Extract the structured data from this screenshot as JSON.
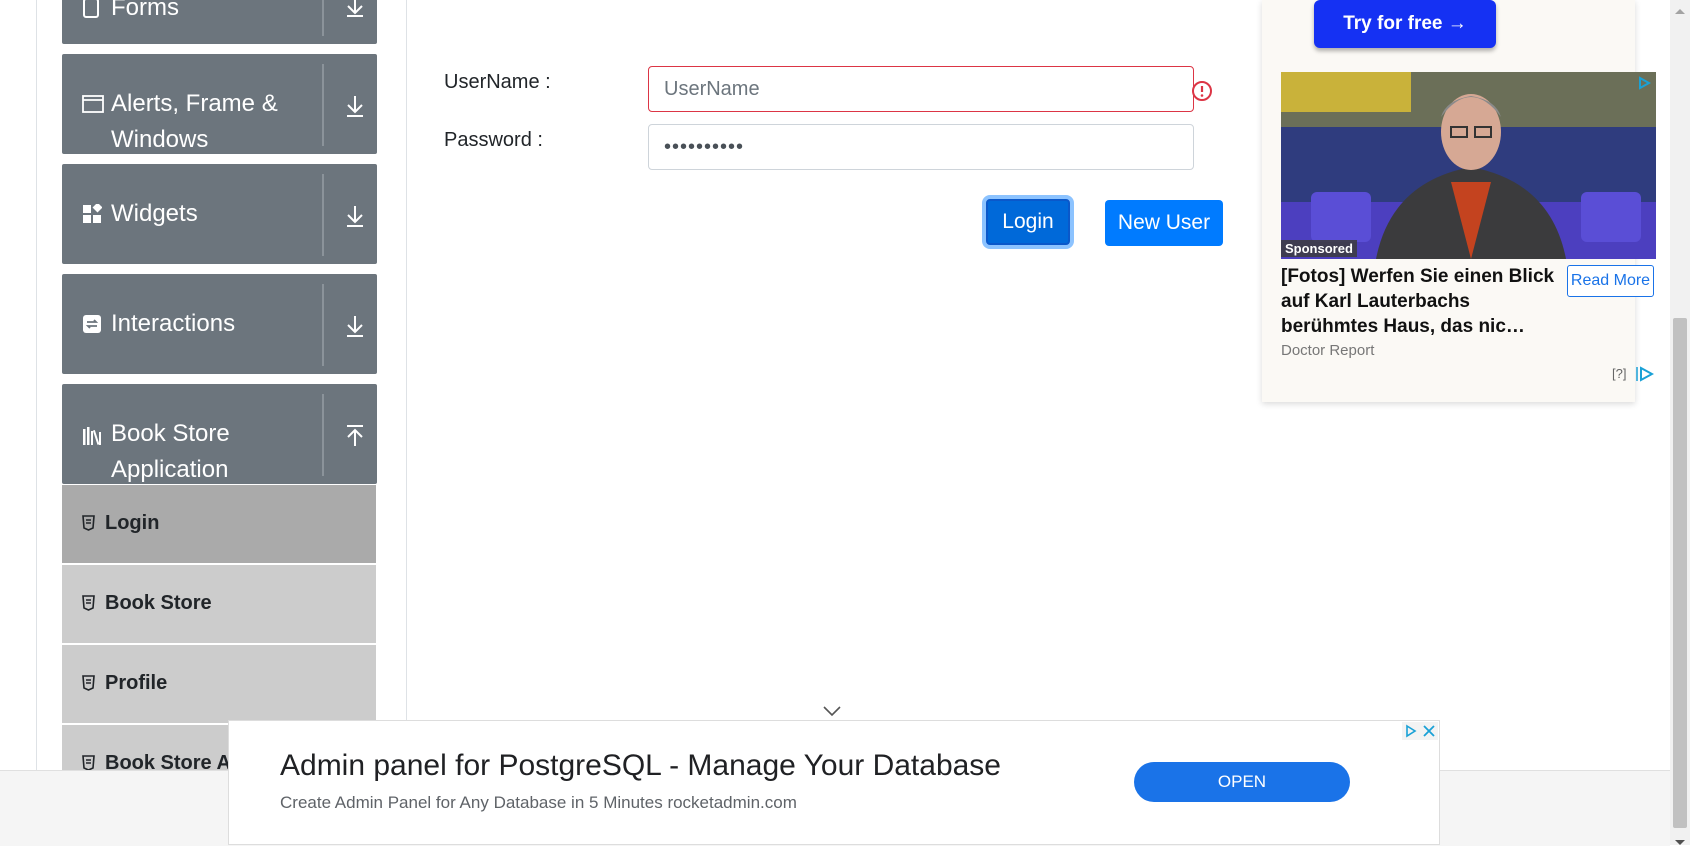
{
  "sidebar": {
    "groups": [
      {
        "title": "Forms",
        "icon": "form-icon",
        "expanded": false
      },
      {
        "title": "Alerts, Frame & Windows",
        "icon": "window-icon",
        "expanded": false
      },
      {
        "title": "Widgets",
        "icon": "widgets-icon",
        "expanded": false
      },
      {
        "title": "Interactions",
        "icon": "interactions-icon",
        "expanded": false
      },
      {
        "title": "Book Store Application",
        "icon": "books-icon",
        "expanded": true
      }
    ],
    "book_store_items": [
      {
        "label": "Login",
        "active": true
      },
      {
        "label": "Book Store",
        "active": false
      },
      {
        "label": "Profile",
        "active": false
      },
      {
        "label": "Book Store API",
        "active": false
      }
    ]
  },
  "form": {
    "username_label": "UserName :",
    "username_placeholder": "UserName",
    "username_value": "",
    "password_label": "Password :",
    "password_value": "••••••••••",
    "login_button": "Login",
    "new_user_button": "New User"
  },
  "side_ad": {
    "try_button": "Try for free →",
    "sponsored": "Sponsored",
    "headline": "[Fotos] Werfen Sie einen Blick auf Karl Lauterbachs berühmtes Haus, das nic…",
    "source": "Doctor Report",
    "read_more": "Read More",
    "help": "[?]"
  },
  "bottom_ad": {
    "title": "Admin panel for PostgreSQL - Manage Your Database",
    "subtitle": "Create Admin Panel for Any Database in 5 Minutes rocketadmin.com",
    "open_button": "OPEN"
  },
  "colors": {
    "sidebar_group": "#6c757d",
    "menu_item": "#cccccc",
    "menu_item_active": "#aaaaaa",
    "primary": "#007bff",
    "invalid": "#dc3545"
  }
}
